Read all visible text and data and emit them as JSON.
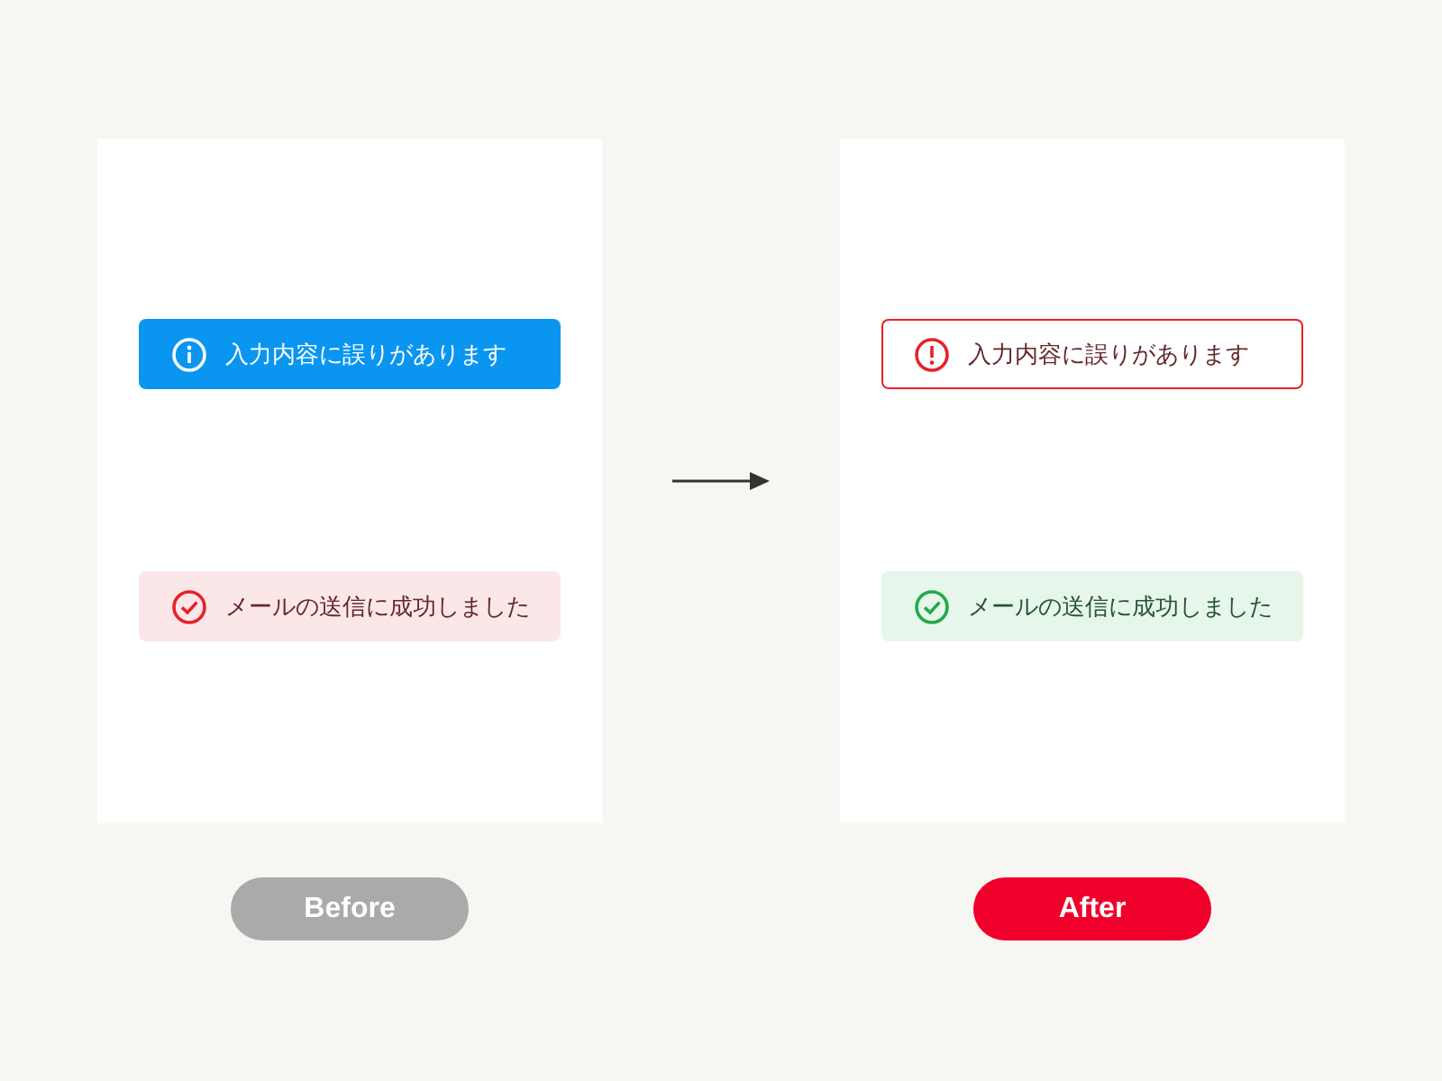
{
  "panels": [
    {
      "label": "Before",
      "color": "#aaaaaa",
      "alerts": [
        {
          "kind": "info",
          "color": "#0a96f0",
          "text": "入力内容に誤りがあります"
        },
        {
          "kind": "success",
          "color": "#e8202a",
          "text": "メールの送信に成功しました"
        }
      ]
    },
    {
      "label": "After",
      "color": "#f0002a",
      "alerts": [
        {
          "kind": "error",
          "color": "#e8202a",
          "text": "入力内容に誤りがあります"
        },
        {
          "kind": "success",
          "color": "#1faa4a",
          "text": "メールの送信に成功しました"
        }
      ]
    }
  ]
}
